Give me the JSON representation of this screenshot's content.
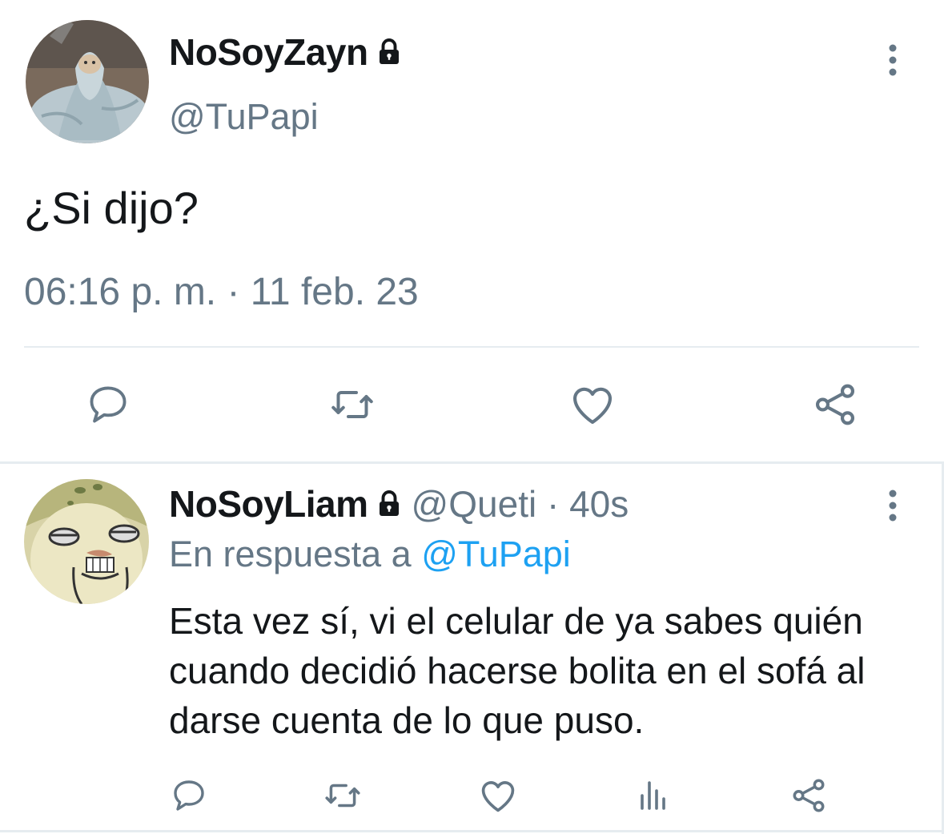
{
  "main_tweet": {
    "display_name": "NoSoyZayn",
    "handle": "@TuPapi",
    "text": "¿Si dijo?",
    "timestamp": "06:16 p. m. · 11 feb. 23",
    "avatar_icon": "cat-in-blanket-avatar",
    "lock_icon": "lock-icon",
    "actions": [
      "reply-icon",
      "retweet-icon",
      "like-icon",
      "share-icon"
    ]
  },
  "reply_tweet": {
    "display_name": "NoSoyLiam",
    "handle": "@Queti",
    "separator": " · ",
    "age": "40s",
    "replying_to_prefix": "En respuesta a ",
    "replying_to_handle": "@TuPapi",
    "text": "Esta vez sí, vi el celular de ya sabes quién cuando decidió hacerse bolita en el sofá al darse cuenta de lo que puso.",
    "avatar_icon": "cartoon-face-avatar",
    "lock_icon": "lock-icon",
    "actions": [
      "reply-icon",
      "retweet-icon",
      "like-icon",
      "analytics-icon",
      "share-icon"
    ]
  },
  "colors": {
    "text": "#14171a",
    "secondary": "#657786",
    "link": "#1da1f2",
    "divider": "#e6ecf0"
  }
}
